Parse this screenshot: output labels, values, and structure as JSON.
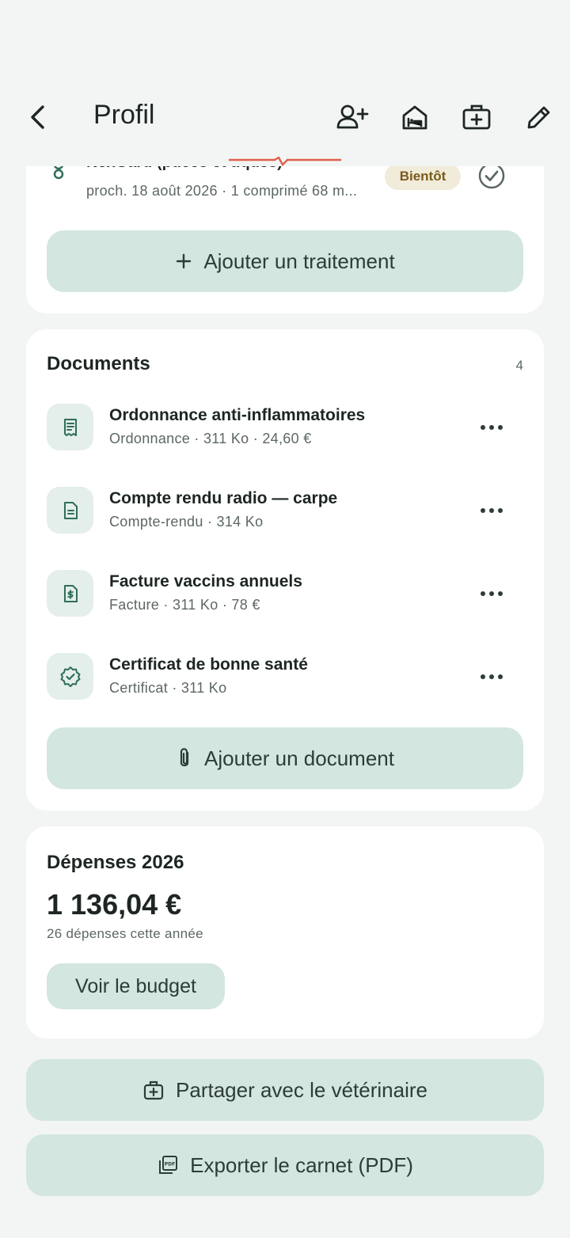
{
  "header": {
    "title": "Profil",
    "icons": [
      "back-icon",
      "add-user-icon",
      "home-bed-icon",
      "medical-kit-icon",
      "edit-pencil-icon"
    ]
  },
  "treatment": {
    "name": "NexGard (puces et tiques)",
    "subtitle": "proch. 18 août 2026 · 1 comprimé 68 m...",
    "badge": "Bientôt",
    "add_label": "Ajouter un traitement"
  },
  "documents": {
    "title": "Documents",
    "count": "4",
    "items": [
      {
        "title": "Ordonnance anti-inflammatoires",
        "subtitle": "Ordonnance · 311 Ko · 24,60 €",
        "icon": "receipt-icon"
      },
      {
        "title": "Compte rendu radio — carpe",
        "subtitle": "Compte-rendu · 314 Ko",
        "icon": "document-icon"
      },
      {
        "title": "Facture vaccins annuels",
        "subtitle": "Facture · 311 Ko · 78 €",
        "icon": "invoice-dollar-icon"
      },
      {
        "title": "Certificat de bonne santé",
        "subtitle": "Certificat · 311 Ko",
        "icon": "certificate-badge-icon"
      }
    ],
    "add_label": "Ajouter un document"
  },
  "expenses": {
    "title": "Dépenses 2026",
    "amount": "1 136,04 €",
    "subtitle": "26 dépenses cette année",
    "budget_label": "Voir le budget"
  },
  "actions": {
    "share_label": "Partager avec le vétérinaire",
    "export_label": "Exporter le carnet (PDF)"
  },
  "colors": {
    "background": "#f3f5f4",
    "card": "#ffffff",
    "button": "#d3e6e0",
    "accent": "#2f6e5a",
    "badge_bg": "#f1ebd9",
    "badge_text": "#7a5a1c"
  }
}
